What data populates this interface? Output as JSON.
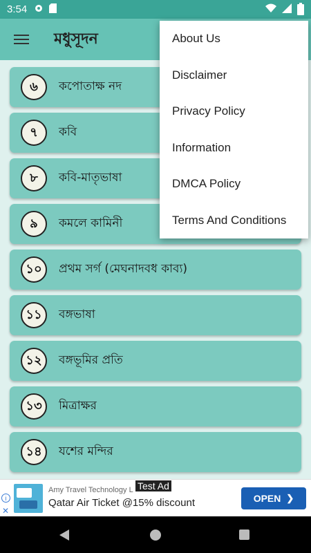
{
  "status_bar": {
    "time": "3:54"
  },
  "app_bar": {
    "title": "মধুসূদন"
  },
  "list": {
    "items": [
      {
        "num": "৬",
        "label": "কপোতাক্ষ নদ"
      },
      {
        "num": "৭",
        "label": "কবি"
      },
      {
        "num": "৮",
        "label": "কবি-মাতৃভাষা"
      },
      {
        "num": "৯",
        "label": "কমলে কামিনী"
      },
      {
        "num": "১০",
        "label": "প্রথম সর্গ (মেঘনাদবধ কাব্য)"
      },
      {
        "num": "১১",
        "label": "বঙ্গভাষা"
      },
      {
        "num": "১২",
        "label": "বঙ্গভূমির প্রতি"
      },
      {
        "num": "১৩",
        "label": "মিত্রাক্ষর"
      },
      {
        "num": "১৪",
        "label": "যশের মন্দির"
      }
    ]
  },
  "menu": {
    "items": [
      "About Us",
      "Disclaimer",
      "Privacy Policy",
      "Information",
      "DMCA Policy",
      "Terms And Conditions"
    ]
  },
  "ad": {
    "tag": "Test Ad",
    "brand": "Amy Travel Technology L",
    "headline": "Qatar Air Ticket @15% discount",
    "cta": "OPEN",
    "info_icon": "i",
    "close_icon": "✕"
  },
  "colors": {
    "status_bar": "#3aa597",
    "app_bar": "#66c2b5",
    "list_item": "#7ccabf",
    "cta": "#1a5fb4"
  }
}
